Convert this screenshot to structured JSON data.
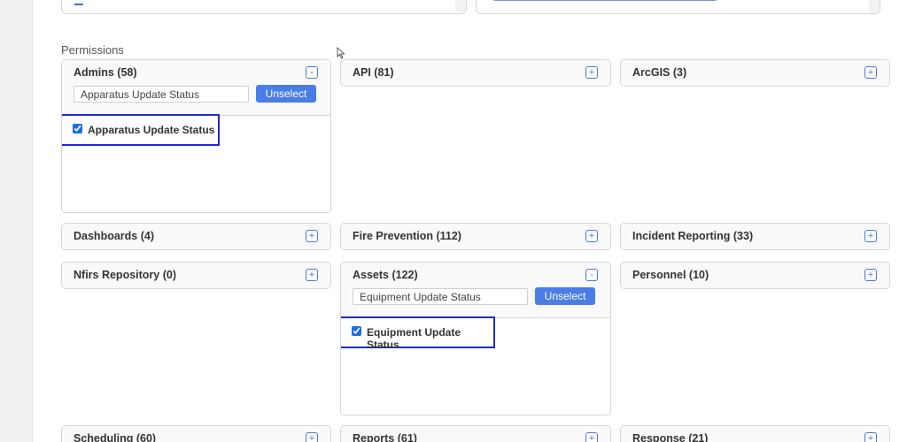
{
  "section_title": "Permissions",
  "cards": {
    "admins": {
      "title": "Admins (58)",
      "toggle": "-",
      "filter_value": "Apparatus Update Status",
      "unselect_label": "Unselect",
      "permission_label": "Apparatus Update Status",
      "permission_checked": true
    },
    "api": {
      "title": "API (81)",
      "toggle": "+"
    },
    "arcgis": {
      "title": "ArcGIS (3)",
      "toggle": "+"
    },
    "dashboards": {
      "title": "Dashboards (4)",
      "toggle": "+"
    },
    "fire_prevention": {
      "title": "Fire Prevention (112)",
      "toggle": "+"
    },
    "incident_reporting": {
      "title": "Incident Reporting (33)",
      "toggle": "+"
    },
    "nfirs_repository": {
      "title": "Nfirs Repository (0)",
      "toggle": "+"
    },
    "assets": {
      "title": "Assets (122)",
      "toggle": "-",
      "filter_value": "Equipment Update Status",
      "unselect_label": "Unselect",
      "permission_label": "Equipment Update Status",
      "permission_checked": true
    },
    "personnel": {
      "title": "Personnel (10)",
      "toggle": "+"
    },
    "scheduling": {
      "title": "Scheduling (60)",
      "toggle": "+"
    },
    "reports": {
      "title": "Reports (61)",
      "toggle": "+"
    },
    "response": {
      "title": "Response (21)",
      "toggle": "+"
    }
  },
  "colors": {
    "accent": "#4a7de6",
    "highlight_border": "#1f2bd0"
  }
}
